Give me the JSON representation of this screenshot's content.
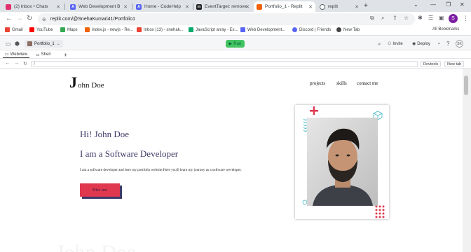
{
  "browser": {
    "tabs": [
      {
        "title": "(2) Inbox • Chats",
        "color": "#e1306c"
      },
      {
        "title": "Web Development B",
        "color": "#5865f2"
      },
      {
        "title": "Home - CodeHelp",
        "color": "#5865f2"
      },
      {
        "title": "EventTarget: remove",
        "color": "#222222"
      },
      {
        "title": "Portfolio_1 - Replit",
        "color": "#f26207"
      },
      {
        "title": "replit",
        "color": "#5f6368"
      }
    ],
    "address": "replit.com/@SnehaKumari41/Portfolio1",
    "profile_initial": "S",
    "bookmarks": [
      "Gmail",
      "YouTube",
      "Maps",
      "index.js - newjs - Re...",
      "Inbox (13) - snehak...",
      "JavaScript array - Ex...",
      "Web Development...",
      "Discord | Friends",
      "New Tab"
    ],
    "all_bookmarks": "All Bookmarks"
  },
  "replit": {
    "repl_name": "Portfolio_1",
    "run_label": "Run",
    "invite_label": "Invite",
    "deploy_label": "Deploy",
    "panel_tabs": [
      "Webview",
      "Shell"
    ],
    "webview_url": "/",
    "devtools_label": "Devtools",
    "newtab_label": "New tab"
  },
  "site": {
    "logo_initial": "J",
    "logo_rest": "ohn Doe",
    "nav": [
      "projects",
      "skills",
      "contact me"
    ],
    "greeting": "Hi! John Doe",
    "role": "I am a Software Developer",
    "description": "I am a software developer and here my portfolio website.Here you'll learn my journey as a software weveloper.",
    "cta": "Hire me",
    "ghost_text": "John Doe",
    "accent": "#e0384f",
    "text_color": "#3d3b66"
  }
}
